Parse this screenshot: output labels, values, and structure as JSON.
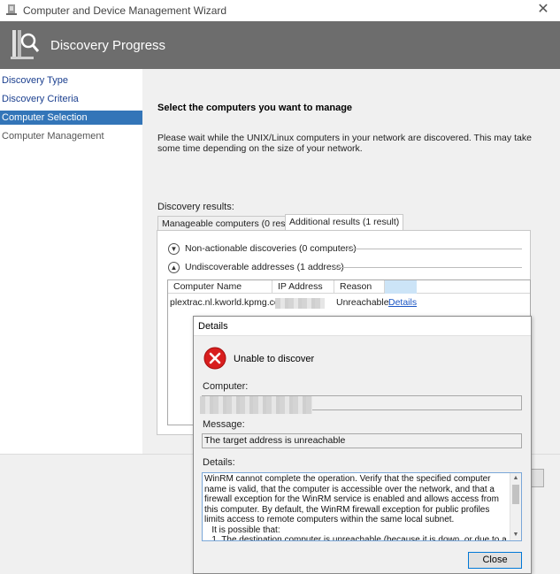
{
  "window": {
    "title": "Computer and Device Management Wizard",
    "close_glyph": "✕"
  },
  "banner": {
    "title": "Discovery Progress"
  },
  "nav": {
    "items": [
      {
        "label": "Discovery Type",
        "state": "link"
      },
      {
        "label": "Discovery Criteria",
        "state": "link"
      },
      {
        "label": "Computer Selection",
        "state": "active"
      },
      {
        "label": "Computer Management",
        "state": "inactive"
      }
    ]
  },
  "main": {
    "heading": "Select the computers you want to manage",
    "description": "Please wait while the UNIX/Linux computers in your network are discovered. This may take some time depending on the size of your network.",
    "results_label": "Discovery results:",
    "tabs": [
      {
        "label": "Manageable computers (0 results)",
        "active": false
      },
      {
        "label": "Additional results (1 result)",
        "active": true
      }
    ],
    "sections": [
      {
        "label": "Non-actionable discoveries (0 computers)"
      },
      {
        "label": "Undiscoverable addresses (1 address)"
      }
    ],
    "grid": {
      "columns": [
        "Computer Name",
        "IP Address",
        "Reason"
      ],
      "rows": [
        {
          "computer_name": "plextrac.nl.kworld.kpmg.com",
          "ip_address": "",
          "reason": "Unreachable",
          "action": "Details"
        }
      ]
    }
  },
  "dialog": {
    "title": "Details",
    "error_text": "Unable to discover",
    "computer_label": "Computer:",
    "computer_value": "",
    "message_label": "Message:",
    "message_value": "The target address is unreachable",
    "details_label": "Details:",
    "details_text": "WinRM cannot complete the operation. Verify that the specified computer name is valid, that the computer is accessible over the network, and that a firewall exception for the WinRM service is enabled and allows access from this computer. By default, the WinRM firewall exception for public profiles limits access to remote computers within the same local subnet.\n   It is possible that:\n   1. The destination computer is unreachable (because it is down, or due to a firewall",
    "close_label": "Close"
  },
  "icons": {
    "app": "wizard-app-icon",
    "banner": "discovery-magnifier-icon",
    "error": "error-x-icon",
    "chevron": "chevron-circle-icon"
  },
  "colors": {
    "banner": "#6d6d6d",
    "nav_active": "#3375b8",
    "link": "#1a55c4",
    "error_red": "#d81e1e"
  }
}
